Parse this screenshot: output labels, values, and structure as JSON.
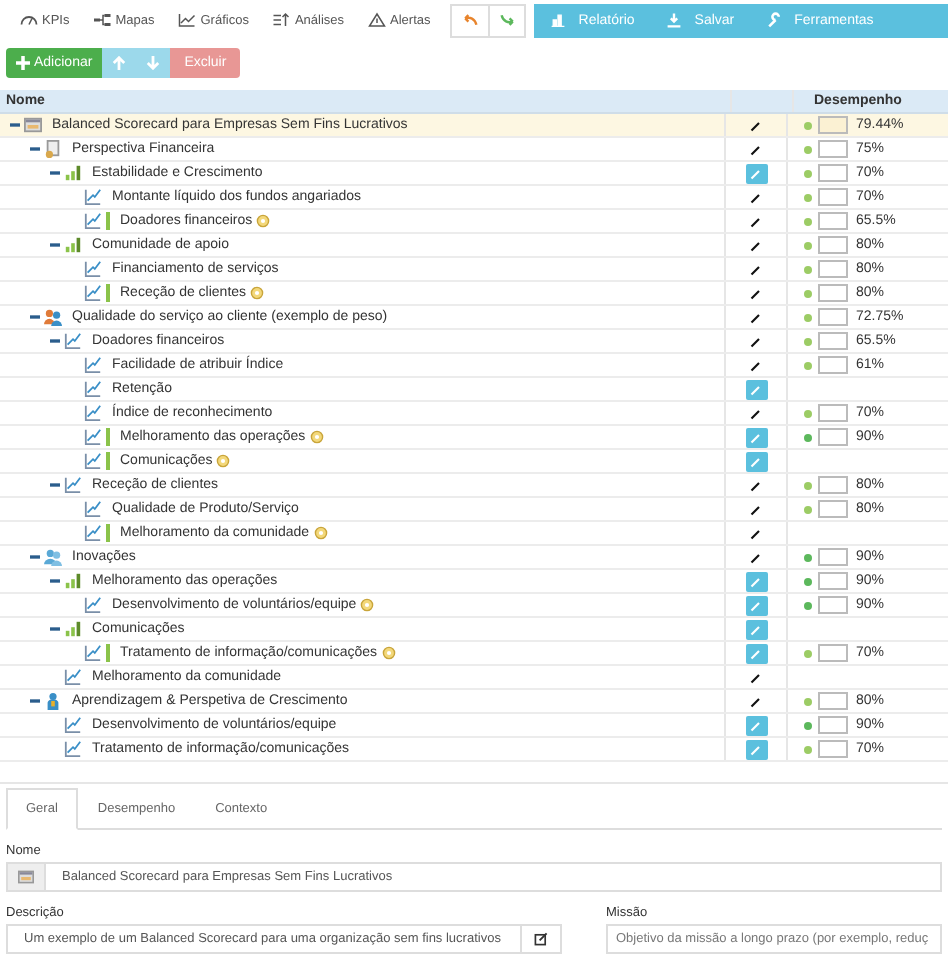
{
  "toolbar": {
    "tabs": [
      {
        "label": "KPIs",
        "kind": "kpi"
      },
      {
        "label": "Mapas",
        "kind": "maps"
      },
      {
        "label": "Gráficos",
        "kind": "charts"
      },
      {
        "label": "Análises",
        "kind": "analysis"
      },
      {
        "label": "Alertas",
        "kind": "alerts"
      }
    ],
    "history": [
      {
        "kind": "undo"
      },
      {
        "kind": "redo"
      }
    ],
    "actions": [
      {
        "label": "Relatório",
        "kind": "report"
      },
      {
        "label": "Salvar",
        "kind": "save"
      },
      {
        "label": "Ferramentas",
        "kind": "tools"
      }
    ]
  },
  "row_actions": [
    {
      "kind": "add",
      "label": "Adicionar",
      "disabled": false
    },
    {
      "kind": "up",
      "disabled": true
    },
    {
      "kind": "down",
      "disabled": true
    },
    {
      "kind": "delete",
      "label": "Excluir",
      "disabled": true
    }
  ],
  "grid": {
    "name_header": "Nome",
    "performance_header": "Desempenho"
  },
  "tree": {
    "name": "Balanced Scorecard para Empresas Sem Fins Lucrativos",
    "kind": "scorecard",
    "selected": true,
    "expanded": true,
    "linked": false,
    "badge": false,
    "edit_highlighted": false,
    "performance": {
      "value": "79.44%",
      "color": "#9ccc65"
    },
    "children": [
      {
        "name": "Perspectiva Financeira",
        "kind": "finance",
        "selected": false,
        "expanded": true,
        "linked": false,
        "badge": false,
        "edit_highlighted": false,
        "performance": {
          "value": "75%",
          "color": "#9ccc65"
        },
        "children": [
          {
            "name": "Estabilidade e Crescimento",
            "kind": "objective",
            "selected": false,
            "expanded": true,
            "linked": false,
            "badge": false,
            "edit_highlighted": true,
            "performance": {
              "value": "70%",
              "color": "#9ccc65"
            },
            "children": [
              {
                "name": "Montante líquido dos fundos angariados",
                "kind": "kpi",
                "selected": false,
                "linked": false,
                "badge": false,
                "edit_highlighted": false,
                "performance": {
                  "value": "70%",
                  "color": "#9ccc65"
                }
              },
              {
                "name": "Doadores financeiros",
                "kind": "kpi",
                "selected": false,
                "linked": true,
                "badge": true,
                "edit_highlighted": false,
                "performance": {
                  "value": "65.5%",
                  "color": "#9ccc65"
                }
              }
            ]
          },
          {
            "name": "Comunidade de apoio",
            "kind": "objective",
            "selected": false,
            "expanded": true,
            "linked": false,
            "badge": false,
            "edit_highlighted": false,
            "performance": {
              "value": "80%",
              "color": "#9ccc65"
            },
            "children": [
              {
                "name": "Financiamento de serviços",
                "kind": "kpi",
                "selected": false,
                "linked": false,
                "badge": false,
                "edit_highlighted": false,
                "performance": {
                  "value": "80%",
                  "color": "#9ccc65"
                }
              },
              {
                "name": "Receção de clientes",
                "kind": "kpi",
                "selected": false,
                "linked": true,
                "badge": true,
                "edit_highlighted": false,
                "performance": {
                  "value": "80%",
                  "color": "#9ccc65"
                }
              }
            ]
          }
        ]
      },
      {
        "name": "Qualidade do serviço ao cliente (exemplo de peso)",
        "kind": "service",
        "selected": false,
        "expanded": true,
        "linked": false,
        "badge": false,
        "edit_highlighted": false,
        "performance": {
          "value": "72.75%",
          "color": "#9ccc65"
        },
        "children": [
          {
            "name": "Doadores financeiros",
            "kind": "kpi",
            "selected": false,
            "expanded": true,
            "linked": false,
            "badge": false,
            "edit_highlighted": false,
            "performance": {
              "value": "65.5%",
              "color": "#9ccc65"
            },
            "children": [
              {
                "name": "Facilidade de atribuir Índice",
                "kind": "kpi",
                "selected": false,
                "linked": false,
                "badge": false,
                "edit_highlighted": false,
                "performance": {
                  "value": "61%",
                  "color": "#9ccc65"
                }
              },
              {
                "name": "Retenção",
                "kind": "kpi",
                "selected": false,
                "linked": false,
                "badge": false,
                "edit_highlighted": true
              },
              {
                "name": "Índice de reconhecimento",
                "kind": "kpi",
                "selected": false,
                "linked": false,
                "badge": false,
                "edit_highlighted": false,
                "performance": {
                  "value": "70%",
                  "color": "#9ccc65"
                }
              },
              {
                "name": "Melhoramento das operações",
                "kind": "kpi",
                "selected": false,
                "linked": true,
                "badge": true,
                "edit_highlighted": true,
                "performance": {
                  "value": "90%",
                  "color": "#5cb85c"
                }
              },
              {
                "name": "Comunicações",
                "kind": "kpi",
                "selected": false,
                "linked": true,
                "badge": true,
                "edit_highlighted": true
              }
            ]
          },
          {
            "name": "Receção de clientes",
            "kind": "kpi",
            "selected": false,
            "expanded": true,
            "linked": false,
            "badge": false,
            "edit_highlighted": false,
            "performance": {
              "value": "80%",
              "color": "#9ccc65"
            },
            "children": [
              {
                "name": "Qualidade de Produto/Serviço",
                "kind": "kpi",
                "selected": false,
                "linked": false,
                "badge": false,
                "edit_highlighted": false,
                "performance": {
                  "value": "80%",
                  "color": "#9ccc65"
                }
              },
              {
                "name": "Melhoramento da comunidade",
                "kind": "kpi",
                "selected": false,
                "linked": true,
                "badge": true,
                "edit_highlighted": false
              }
            ]
          }
        ]
      },
      {
        "name": "Inovações",
        "kind": "innovation",
        "selected": false,
        "expanded": true,
        "linked": false,
        "badge": false,
        "edit_highlighted": false,
        "performance": {
          "value": "90%",
          "color": "#5cb85c"
        },
        "children": [
          {
            "name": "Melhoramento das operações",
            "kind": "objective",
            "selected": false,
            "expanded": true,
            "linked": false,
            "badge": false,
            "edit_highlighted": true,
            "performance": {
              "value": "90%",
              "color": "#5cb85c"
            },
            "children": [
              {
                "name": "Desenvolvimento de voluntários/equipe",
                "kind": "kpi",
                "selected": false,
                "linked": false,
                "badge": true,
                "edit_highlighted": true,
                "performance": {
                  "value": "90%",
                  "color": "#5cb85c"
                }
              }
            ]
          },
          {
            "name": "Comunicações",
            "kind": "objective",
            "selected": false,
            "expanded": true,
            "linked": false,
            "badge": false,
            "edit_highlighted": true,
            "children": [
              {
                "name": "Tratamento de informação/comunicações",
                "kind": "kpi",
                "selected": false,
                "linked": true,
                "badge": true,
                "edit_highlighted": true,
                "performance": {
                  "value": "70%",
                  "color": "#9ccc65"
                }
              }
            ]
          },
          {
            "name": "Melhoramento da comunidade",
            "kind": "kpi",
            "selected": false,
            "linked": false,
            "badge": false,
            "edit_highlighted": false
          }
        ]
      },
      {
        "name": "Aprendizagem & Perspetiva de Crescimento",
        "kind": "learning",
        "selected": false,
        "expanded": true,
        "linked": false,
        "badge": false,
        "edit_highlighted": false,
        "performance": {
          "value": "80%",
          "color": "#9ccc65"
        },
        "children": [
          {
            "name": "Desenvolvimento de voluntários/equipe",
            "kind": "kpi",
            "selected": false,
            "linked": false,
            "badge": false,
            "edit_highlighted": true,
            "performance": {
              "value": "90%",
              "color": "#5cb85c"
            }
          },
          {
            "name": "Tratamento de informação/comunicações",
            "kind": "kpi",
            "selected": false,
            "linked": false,
            "badge": false,
            "edit_highlighted": true,
            "performance": {
              "value": "70%",
              "color": "#9ccc65"
            }
          }
        ]
      }
    ]
  },
  "details": {
    "tabs": [
      {
        "label": "Geral",
        "selected": true
      },
      {
        "label": "Desempenho",
        "selected": false
      },
      {
        "label": "Contexto",
        "selected": false
      }
    ],
    "name_label": "Nome",
    "name_value": "Balanced Scorecard para Empresas Sem Fins Lucrativos",
    "description_label": "Descrição",
    "description_value": "Um exemplo de um Balanced Scorecard para uma organização sem fins lucrativos",
    "mission_label": "Missão",
    "mission_placeholder": "Objetivo da missão a longo prazo (por exemplo, reduç"
  }
}
